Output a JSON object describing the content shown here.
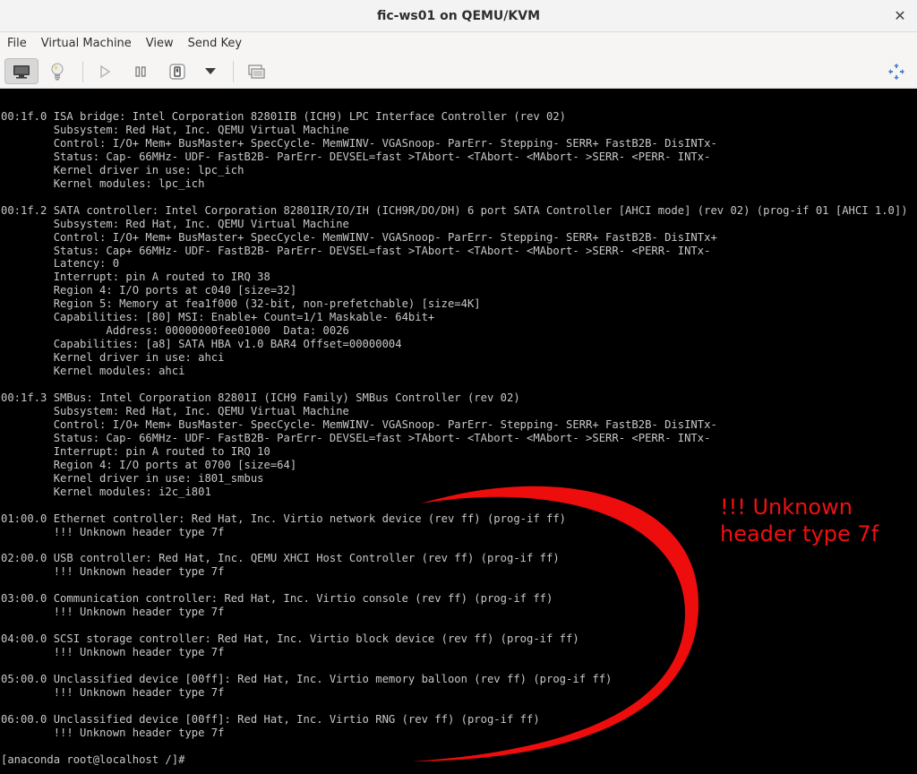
{
  "window": {
    "title": "fic-ws01 on QEMU/KVM",
    "close_glyph": "✕"
  },
  "menubar": {
    "items": [
      "File",
      "Virtual Machine",
      "View",
      "Send Key"
    ]
  },
  "toolbar": {
    "icons": [
      "monitor-icon",
      "lightbulb-icon",
      "play-icon",
      "pause-icon",
      "power-icon",
      "chevron-down-icon",
      "screenshot-icon",
      "fullscreen-icon"
    ]
  },
  "console": {
    "lines": [
      "00:1f.0 ISA bridge: Intel Corporation 82801IB (ICH9) LPC Interface Controller (rev 02)",
      "        Subsystem: Red Hat, Inc. QEMU Virtual Machine",
      "        Control: I/O+ Mem+ BusMaster+ SpecCycle- MemWINV- VGASnoop- ParErr- Stepping- SERR+ FastB2B- DisINTx-",
      "        Status: Cap- 66MHz- UDF- FastB2B- ParErr- DEVSEL=fast >TAbort- <TAbort- <MAbort- >SERR- <PERR- INTx-",
      "        Kernel driver in use: lpc_ich",
      "        Kernel modules: lpc_ich",
      "",
      "00:1f.2 SATA controller: Intel Corporation 82801IR/IO/IH (ICH9R/DO/DH) 6 port SATA Controller [AHCI mode] (rev 02) (prog-if 01 [AHCI 1.0])",
      "        Subsystem: Red Hat, Inc. QEMU Virtual Machine",
      "        Control: I/O+ Mem+ BusMaster+ SpecCycle- MemWINV- VGASnoop- ParErr- Stepping- SERR+ FastB2B- DisINTx+",
      "        Status: Cap+ 66MHz- UDF- FastB2B- ParErr- DEVSEL=fast >TAbort- <TAbort- <MAbort- >SERR- <PERR- INTx-",
      "        Latency: 0",
      "        Interrupt: pin A routed to IRQ 38",
      "        Region 4: I/O ports at c040 [size=32]",
      "        Region 5: Memory at fea1f000 (32-bit, non-prefetchable) [size=4K]",
      "        Capabilities: [80] MSI: Enable+ Count=1/1 Maskable- 64bit+",
      "                Address: 00000000fee01000  Data: 0026",
      "        Capabilities: [a8] SATA HBA v1.0 BAR4 Offset=00000004",
      "        Kernel driver in use: ahci",
      "        Kernel modules: ahci",
      "",
      "00:1f.3 SMBus: Intel Corporation 82801I (ICH9 Family) SMBus Controller (rev 02)",
      "        Subsystem: Red Hat, Inc. QEMU Virtual Machine",
      "        Control: I/O+ Mem+ BusMaster- SpecCycle- MemWINV- VGASnoop- ParErr- Stepping- SERR+ FastB2B- DisINTx-",
      "        Status: Cap- 66MHz- UDF- FastB2B- ParErr- DEVSEL=fast >TAbort- <TAbort- <MAbort- >SERR- <PERR- INTx-",
      "        Interrupt: pin A routed to IRQ 10",
      "        Region 4: I/O ports at 0700 [size=64]",
      "        Kernel driver in use: i801_smbus",
      "        Kernel modules: i2c_i801",
      "",
      "01:00.0 Ethernet controller: Red Hat, Inc. Virtio network device (rev ff) (prog-if ff)",
      "        !!! Unknown header type 7f",
      "",
      "02:00.0 USB controller: Red Hat, Inc. QEMU XHCI Host Controller (rev ff) (prog-if ff)",
      "        !!! Unknown header type 7f",
      "",
      "03:00.0 Communication controller: Red Hat, Inc. Virtio console (rev ff) (prog-if ff)",
      "        !!! Unknown header type 7f",
      "",
      "04:00.0 SCSI storage controller: Red Hat, Inc. Virtio block device (rev ff) (prog-if ff)",
      "        !!! Unknown header type 7f",
      "",
      "05:00.0 Unclassified device [00ff]: Red Hat, Inc. Virtio memory balloon (rev ff) (prog-if ff)",
      "        !!! Unknown header type 7f",
      "",
      "06:00.0 Unclassified device [00ff]: Red Hat, Inc. Virtio RNG (rev ff) (prog-if ff)",
      "        !!! Unknown header type 7f",
      "",
      "[anaconda root@localhost /]#"
    ]
  },
  "annotation": {
    "text": "!!! Unknown\nheader type 7f",
    "color": "#ee1111"
  },
  "colors": {
    "console_bg": "#000000",
    "console_fg": "#c8c8c8",
    "annotation_red": "#ee1111"
  }
}
